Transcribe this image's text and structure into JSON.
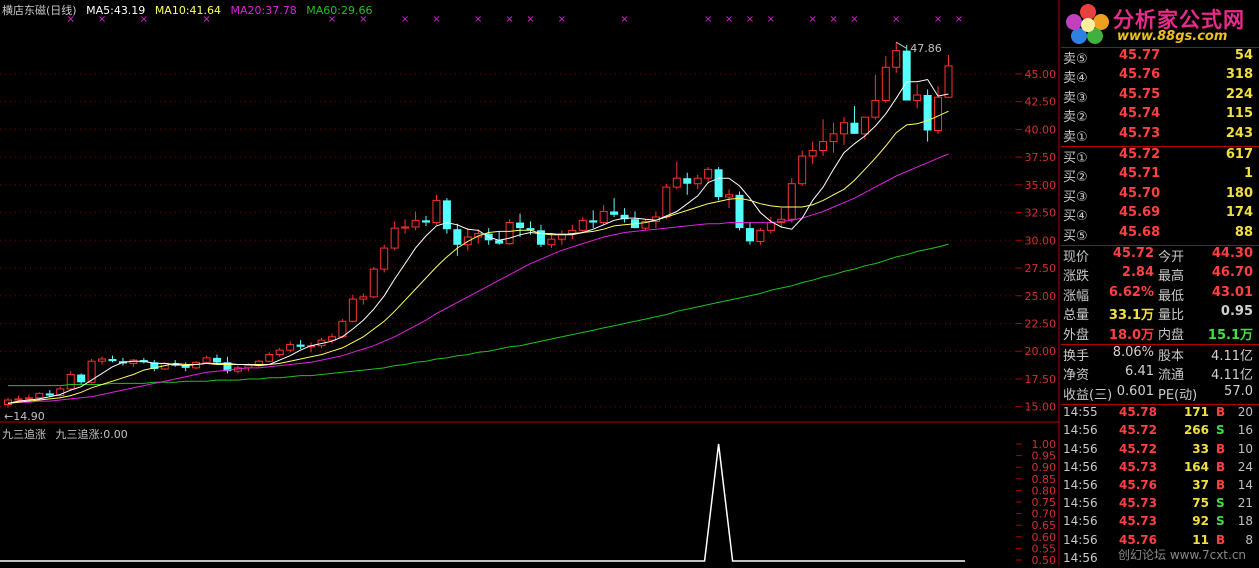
{
  "header": {
    "stock_name": "横店东磁(日线)",
    "ma5": "MA5:43.19",
    "ma10": "MA10:41.64",
    "ma20": "MA20:37.78",
    "ma60": "MA60:29.66"
  },
  "colors": {
    "up": "#ff3030",
    "down": "#54ffff",
    "ma5": "#ffffff",
    "ma10": "#ffff60",
    "ma20": "#e020e0",
    "ma60": "#20c020",
    "marker": "#e020e0",
    "grid": "#800000"
  },
  "price_axis": {
    "ticks": [
      "45.00",
      "42.50",
      "40.00",
      "37.50",
      "35.00",
      "32.50",
      "30.00",
      "27.50",
      "25.00",
      "22.50",
      "20.00",
      "17.50",
      "15.00"
    ],
    "min": 13.8,
    "max": 49.5
  },
  "annotations": {
    "high_label": "47.86",
    "low_label": "14.90"
  },
  "indicator": {
    "name": "九三追涨",
    "value_label": "九三追涨:0.00",
    "ticks": [
      "1.00",
      "0.95",
      "0.90",
      "0.85",
      "0.80",
      "0.75",
      "0.70",
      "0.65",
      "0.60",
      "0.55",
      "0.50"
    ],
    "signal_candle_index": 68
  },
  "chart_data": {
    "type": "candlestick",
    "title": "横店东磁(日线)",
    "candles": [
      [
        15.2,
        15.8,
        14.9,
        15.6
      ],
      [
        15.6,
        16.0,
        15.4,
        15.7
      ],
      [
        15.7,
        16.1,
        15.5,
        15.8
      ],
      [
        15.8,
        16.3,
        15.6,
        16.2
      ],
      [
        16.2,
        16.5,
        15.9,
        16.0
      ],
      [
        16.0,
        16.8,
        15.9,
        16.6
      ],
      [
        16.6,
        18.2,
        16.5,
        17.9
      ],
      [
        17.9,
        18.0,
        17.0,
        17.2
      ],
      [
        17.2,
        19.3,
        17.1,
        19.1
      ],
      [
        19.1,
        19.5,
        18.8,
        19.3
      ],
      [
        19.3,
        19.6,
        19.0,
        19.1
      ],
      [
        19.1,
        19.4,
        18.7,
        18.9
      ],
      [
        18.9,
        19.3,
        18.6,
        19.2
      ],
      [
        19.2,
        19.4,
        18.9,
        19.0
      ],
      [
        19.0,
        19.2,
        18.2,
        18.4
      ],
      [
        18.4,
        19.0,
        18.3,
        18.9
      ],
      [
        18.9,
        19.2,
        18.6,
        18.7
      ],
      [
        18.7,
        19.0,
        18.2,
        18.5
      ],
      [
        18.5,
        19.1,
        18.4,
        19.0
      ],
      [
        19.0,
        19.6,
        18.9,
        19.4
      ],
      [
        19.4,
        19.7,
        18.8,
        19.0
      ],
      [
        19.0,
        19.5,
        18.0,
        18.2
      ],
      [
        18.2,
        18.7,
        18.0,
        18.5
      ],
      [
        18.5,
        18.9,
        18.2,
        18.7
      ],
      [
        18.7,
        19.2,
        18.6,
        19.1
      ],
      [
        19.1,
        19.9,
        19.0,
        19.7
      ],
      [
        19.7,
        20.3,
        19.5,
        20.1
      ],
      [
        20.1,
        20.9,
        19.9,
        20.6
      ],
      [
        20.6,
        21.0,
        20.2,
        20.4
      ],
      [
        20.4,
        20.8,
        19.9,
        20.5
      ],
      [
        20.5,
        21.2,
        20.3,
        21.0
      ],
      [
        21.0,
        21.6,
        20.7,
        21.3
      ],
      [
        21.3,
        22.9,
        21.2,
        22.7
      ],
      [
        22.7,
        25.1,
        22.6,
        24.7
      ],
      [
        24.7,
        25.2,
        24.2,
        24.9
      ],
      [
        24.9,
        27.6,
        24.8,
        27.4
      ],
      [
        27.4,
        29.6,
        27.1,
        29.3
      ],
      [
        29.3,
        31.7,
        29.1,
        31.1
      ],
      [
        31.1,
        31.9,
        30.6,
        31.2
      ],
      [
        31.2,
        32.6,
        30.9,
        31.8
      ],
      [
        31.8,
        32.2,
        31.3,
        31.6
      ],
      [
        31.6,
        34.1,
        31.4,
        33.6
      ],
      [
        33.6,
        33.8,
        30.6,
        31.0
      ],
      [
        31.0,
        31.5,
        28.6,
        29.6
      ],
      [
        29.6,
        31.1,
        29.1,
        30.3
      ],
      [
        30.3,
        31.0,
        29.7,
        30.6
      ],
      [
        30.6,
        31.1,
        29.6,
        30.0
      ],
      [
        30.0,
        30.8,
        29.6,
        29.7
      ],
      [
        29.7,
        31.9,
        29.6,
        31.6
      ],
      [
        31.6,
        32.4,
        30.3,
        31.1
      ],
      [
        31.1,
        31.7,
        30.5,
        30.9
      ],
      [
        30.9,
        31.4,
        29.4,
        29.6
      ],
      [
        29.6,
        30.6,
        29.3,
        30.1
      ],
      [
        30.1,
        30.9,
        29.6,
        30.6
      ],
      [
        30.6,
        31.4,
        30.1,
        30.9
      ],
      [
        30.9,
        32.1,
        30.6,
        31.8
      ],
      [
        31.8,
        32.7,
        31.1,
        31.6
      ],
      [
        31.6,
        33.2,
        31.4,
        32.6
      ],
      [
        32.6,
        33.8,
        32.1,
        32.3
      ],
      [
        32.3,
        32.9,
        31.6,
        31.9
      ],
      [
        31.9,
        32.6,
        31.1,
        31.1
      ],
      [
        31.1,
        31.9,
        30.9,
        31.7
      ],
      [
        31.7,
        32.6,
        31.1,
        32.1
      ],
      [
        32.1,
        35.1,
        31.9,
        34.8
      ],
      [
        34.8,
        37.1,
        34.6,
        35.6
      ],
      [
        35.6,
        36.1,
        34.1,
        35.1
      ],
      [
        35.1,
        35.9,
        34.6,
        35.6
      ],
      [
        35.6,
        36.6,
        35.1,
        36.4
      ],
      [
        36.4,
        36.6,
        33.6,
        33.9
      ],
      [
        33.9,
        34.6,
        32.9,
        34.1
      ],
      [
        34.1,
        34.4,
        30.9,
        31.1
      ],
      [
        31.1,
        31.6,
        29.6,
        29.9
      ],
      [
        29.9,
        31.1,
        29.6,
        30.9
      ],
      [
        30.9,
        32.1,
        30.6,
        31.6
      ],
      [
        31.6,
        32.9,
        31.1,
        31.9
      ],
      [
        31.9,
        35.6,
        31.6,
        35.1
      ],
      [
        35.1,
        38.1,
        34.9,
        37.6
      ],
      [
        37.6,
        38.9,
        36.9,
        38.1
      ],
      [
        38.1,
        40.9,
        37.6,
        38.9
      ],
      [
        38.9,
        40.6,
        37.9,
        39.6
      ],
      [
        39.6,
        41.1,
        38.6,
        40.6
      ],
      [
        40.6,
        42.1,
        39.6,
        39.6
      ],
      [
        39.6,
        41.1,
        39.1,
        41.1
      ],
      [
        41.1,
        44.9,
        40.9,
        42.6
      ],
      [
        42.6,
        46.6,
        42.4,
        45.6
      ],
      [
        45.6,
        47.86,
        45.1,
        47.1
      ],
      [
        47.1,
        47.6,
        43.9,
        42.6
      ],
      [
        42.6,
        44.1,
        41.9,
        43.1
      ],
      [
        43.1,
        43.6,
        38.9,
        39.9
      ],
      [
        39.9,
        43.9,
        39.6,
        42.9
      ],
      [
        42.9,
        46.7,
        43.01,
        45.72
      ]
    ],
    "ma5": [
      15.3,
      15.5,
      15.6,
      15.7,
      15.9,
      16.1,
      16.5,
      16.8,
      17.4,
      18.0,
      18.6,
      19.0,
      19.1,
      19.1,
      18.9,
      18.9,
      18.8,
      18.7,
      18.8,
      18.9,
      18.9,
      18.9,
      18.8,
      18.8,
      18.7,
      18.8,
      19.2,
      19.6,
      20.1,
      20.5,
      20.7,
      20.9,
      21.3,
      22.0,
      22.8,
      23.8,
      25.0,
      26.5,
      27.9,
      29.3,
      30.4,
      31.3,
      31.6,
      31.4,
      31.0,
      30.9,
      30.3,
      30.0,
      30.2,
      30.5,
      30.7,
      30.6,
      30.6,
      30.5,
      30.5,
      30.7,
      31.0,
      31.4,
      31.8,
      32.0,
      32.0,
      31.9,
      31.8,
      32.2,
      32.6,
      33.3,
      34.0,
      35.2,
      35.6,
      35.6,
      34.9,
      33.8,
      32.5,
      31.7,
      31.2,
      31.0,
      32.0,
      33.6,
      34.8,
      36.4,
      37.9,
      38.7,
      39.4,
      40.3,
      41.4,
      42.8,
      44.3,
      44.3,
      44.5,
      43.0,
      43.19
    ],
    "ma10": [
      15.3,
      15.4,
      15.5,
      15.6,
      15.7,
      15.8,
      16.0,
      16.3,
      16.7,
      17.0,
      17.3,
      17.6,
      17.9,
      18.3,
      18.5,
      18.7,
      18.9,
      18.8,
      18.8,
      18.9,
      18.8,
      18.8,
      18.8,
      18.8,
      18.8,
      18.8,
      18.9,
      19.1,
      19.3,
      19.5,
      19.7,
      20.0,
      20.3,
      20.8,
      21.3,
      22.0,
      22.7,
      23.6,
      24.6,
      25.6,
      26.6,
      27.6,
      28.5,
      29.3,
      29.9,
      30.4,
      30.7,
      30.8,
      30.8,
      30.9,
      30.9,
      30.6,
      30.5,
      30.5,
      30.6,
      30.7,
      30.8,
      31.0,
      31.3,
      31.4,
      31.5,
      31.6,
      31.8,
      32.1,
      32.4,
      32.7,
      33.0,
      33.3,
      33.5,
      33.7,
      33.8,
      33.6,
      33.3,
      33.1,
      33.0,
      33.0,
      33.0,
      33.2,
      33.6,
      34.1,
      34.6,
      35.4,
      36.4,
      37.4,
      38.5,
      39.7,
      40.4,
      40.5,
      40.8,
      41.2,
      41.64
    ],
    "ma20": [
      15.3,
      15.4,
      15.4,
      15.5,
      15.5,
      15.6,
      15.7,
      15.8,
      15.9,
      16.1,
      16.3,
      16.5,
      16.7,
      16.9,
      17.1,
      17.3,
      17.5,
      17.7,
      17.9,
      18.1,
      18.2,
      18.3,
      18.4,
      18.5,
      18.5,
      18.6,
      18.7,
      18.8,
      18.9,
      19.0,
      19.2,
      19.4,
      19.6,
      19.9,
      20.2,
      20.5,
      20.9,
      21.3,
      21.8,
      22.3,
      22.8,
      23.4,
      23.9,
      24.4,
      24.9,
      25.4,
      25.9,
      26.4,
      26.9,
      27.4,
      27.9,
      28.3,
      28.7,
      29.1,
      29.4,
      29.7,
      30.0,
      30.3,
      30.5,
      30.7,
      30.8,
      30.9,
      31.0,
      31.1,
      31.2,
      31.3,
      31.4,
      31.5,
      31.5,
      31.6,
      31.6,
      31.6,
      31.6,
      31.6,
      31.7,
      31.8,
      32.0,
      32.3,
      32.6,
      33.0,
      33.4,
      33.8,
      34.3,
      34.8,
      35.3,
      35.8,
      36.2,
      36.6,
      37.0,
      37.4,
      37.78
    ],
    "ma60": [
      16.9,
      16.9,
      16.9,
      16.9,
      16.9,
      16.9,
      17.0,
      17.0,
      17.0,
      17.0,
      17.1,
      17.1,
      17.1,
      17.1,
      17.2,
      17.2,
      17.2,
      17.3,
      17.3,
      17.3,
      17.4,
      17.4,
      17.4,
      17.5,
      17.5,
      17.6,
      17.6,
      17.7,
      17.8,
      17.8,
      17.9,
      18.0,
      18.1,
      18.2,
      18.3,
      18.4,
      18.5,
      18.7,
      18.8,
      19.0,
      19.1,
      19.3,
      19.4,
      19.6,
      19.7,
      19.9,
      20.0,
      20.2,
      20.4,
      20.5,
      20.7,
      20.9,
      21.1,
      21.3,
      21.5,
      21.7,
      21.9,
      22.1,
      22.3,
      22.5,
      22.7,
      22.9,
      23.1,
      23.3,
      23.6,
      23.8,
      24.0,
      24.2,
      24.4,
      24.6,
      24.8,
      25.0,
      25.2,
      25.5,
      25.7,
      25.9,
      26.2,
      26.4,
      26.7,
      26.9,
      27.2,
      27.4,
      27.7,
      27.9,
      28.2,
      28.5,
      28.7,
      29.0,
      29.2,
      29.4,
      29.66
    ],
    "markers": [
      6,
      9,
      13,
      19,
      31,
      34,
      38,
      41,
      45,
      48,
      50,
      53,
      59,
      67,
      69,
      71,
      73,
      77,
      79,
      81,
      85,
      89,
      91
    ]
  },
  "quote": {
    "asks": [
      {
        "label": "卖⑤",
        "price": "45.77",
        "vol": "54"
      },
      {
        "label": "卖④",
        "price": "45.76",
        "vol": "318"
      },
      {
        "label": "卖③",
        "price": "45.75",
        "vol": "224"
      },
      {
        "label": "卖②",
        "price": "45.74",
        "vol": "115"
      },
      {
        "label": "卖①",
        "price": "45.73",
        "vol": "243"
      }
    ],
    "bids": [
      {
        "label": "买①",
        "price": "45.72",
        "vol": "617"
      },
      {
        "label": "买②",
        "price": "45.71",
        "vol": "1"
      },
      {
        "label": "买③",
        "price": "45.70",
        "vol": "180"
      },
      {
        "label": "买④",
        "price": "45.69",
        "vol": "174"
      },
      {
        "label": "买⑤",
        "price": "45.68",
        "vol": "88"
      }
    ],
    "stats": [
      {
        "l1": "现价",
        "v1": "45.72",
        "l2": "今开",
        "v2": "44.30",
        "c1": "#ff4040",
        "c2": "#ff4040"
      },
      {
        "l1": "涨跌",
        "v1": "2.84",
        "l2": "最高",
        "v2": "46.70",
        "c1": "#ff4040",
        "c2": "#ff4040"
      },
      {
        "l1": "涨幅",
        "v1": "6.62%",
        "l2": "最低",
        "v2": "43.01",
        "c1": "#ff4040",
        "c2": "#ff4040"
      },
      {
        "l1": "总量",
        "v1": "33.1万",
        "l2": "量比",
        "v2": "0.95",
        "c1": "#f0e040",
        "c2": "#d0d0d0"
      },
      {
        "l1": "外盘",
        "v1": "18.0万",
        "l2": "内盘",
        "v2": "15.1万",
        "c1": "#ff4040",
        "c2": "#40e040"
      }
    ],
    "finance": [
      {
        "l1": "换手",
        "v1": "8.06%",
        "l2": "股本",
        "v2": "4.11亿"
      },
      {
        "l1": "净资",
        "v1": "6.41",
        "l2": "流通",
        "v2": "4.11亿"
      },
      {
        "l1": "收益(三)",
        "v1": "0.601",
        "l2": "PE(动)",
        "v2": "57.0"
      }
    ],
    "trades": [
      {
        "time": "14:55",
        "price": "45.78",
        "vol": "171",
        "side": "B",
        "n": "20"
      },
      {
        "time": "14:56",
        "price": "45.72",
        "vol": "266",
        "side": "S",
        "n": "16"
      },
      {
        "time": "14:56",
        "price": "45.72",
        "vol": "33",
        "side": "B",
        "n": "10"
      },
      {
        "time": "14:56",
        "price": "45.73",
        "vol": "164",
        "side": "B",
        "n": "24"
      },
      {
        "time": "14:56",
        "price": "45.76",
        "vol": "37",
        "side": "B",
        "n": "14"
      },
      {
        "time": "14:56",
        "price": "45.73",
        "vol": "75",
        "side": "S",
        "n": "21"
      },
      {
        "time": "14:56",
        "price": "45.73",
        "vol": "92",
        "side": "S",
        "n": "18"
      },
      {
        "time": "14:56",
        "price": "45.76",
        "vol": "11",
        "side": "B",
        "n": "8"
      },
      {
        "time": "14:56",
        "price": "",
        "vol": "",
        "side": "",
        "n": ""
      }
    ]
  },
  "logo": {
    "title": "分析家公式网",
    "url": "www.88gs.com"
  },
  "watermark": "创幻论坛 www.7cxt.cn"
}
